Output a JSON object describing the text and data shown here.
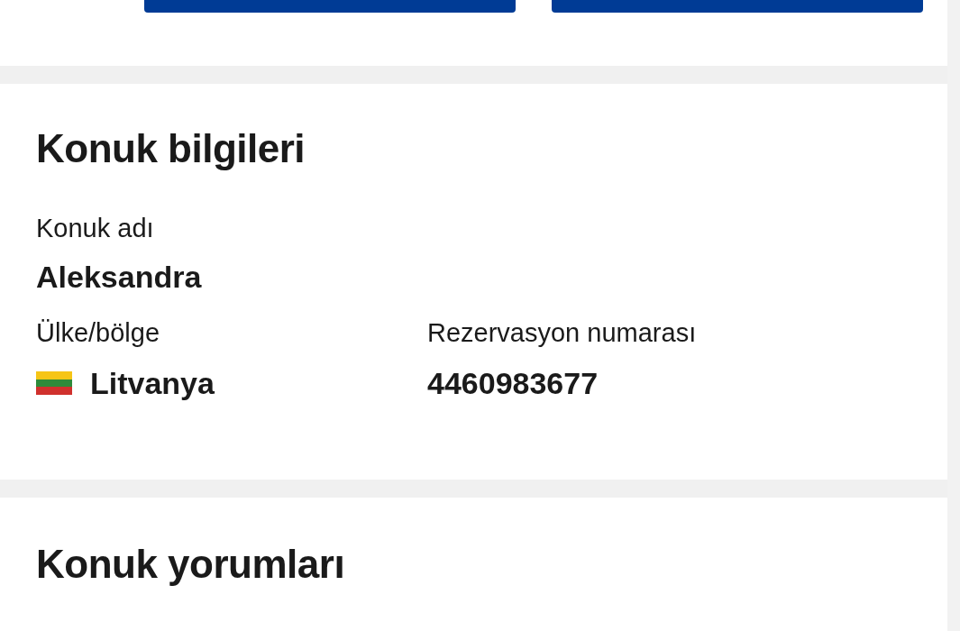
{
  "top_buttons": [
    {
      "kind": "primary"
    },
    {
      "kind": "primary"
    }
  ],
  "guest_info": {
    "title": "Konuk bilgileri",
    "name_label": "Konuk adı",
    "name_value": "Aleksandra",
    "country_label": "Ülke/bölge",
    "country_value": "Litvanya",
    "reservation_label": "Rezervasyon numarası",
    "reservation_value": "4460983677"
  },
  "guest_reviews": {
    "title": "Konuk yorumları"
  }
}
